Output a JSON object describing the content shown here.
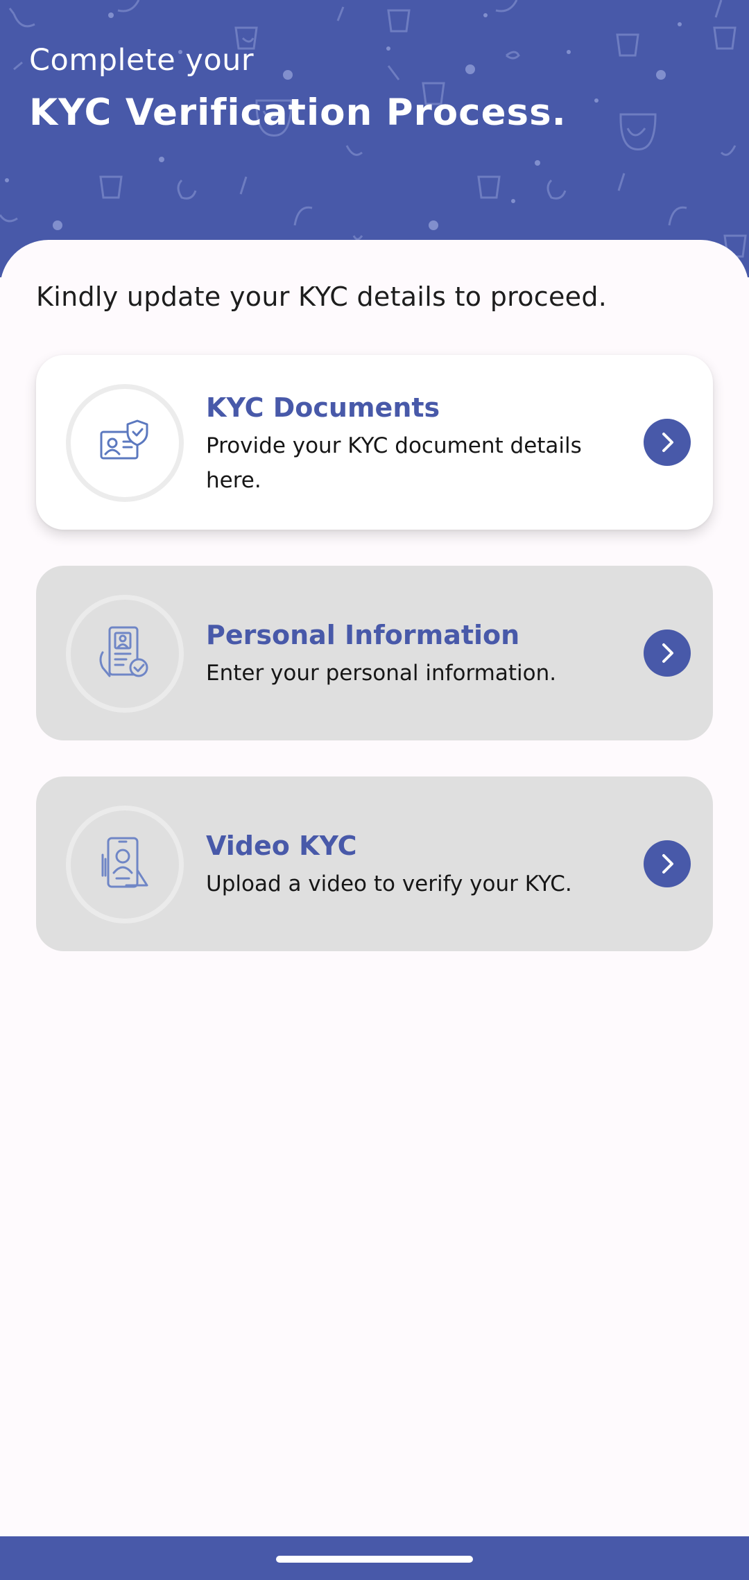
{
  "header": {
    "subtitle": "Complete your",
    "title": "KYC Verification Process."
  },
  "instruction": "Kindly update your KYC details to proceed.",
  "cards": [
    {
      "title": "KYC Documents",
      "description": "Provide your KYC document details here.",
      "icon": "id-card-shield-icon",
      "state": "active"
    },
    {
      "title": "Personal Information",
      "description": "Enter your personal information.",
      "icon": "profile-document-check-icon",
      "state": "inactive"
    },
    {
      "title": "Video KYC",
      "description": "Upload a video to verify your KYC.",
      "icon": "phone-selfie-icon",
      "state": "inactive"
    }
  ],
  "colors": {
    "brand": "#4859a9",
    "card_inactive": "#dfdfdf",
    "background": "#fefafd"
  }
}
